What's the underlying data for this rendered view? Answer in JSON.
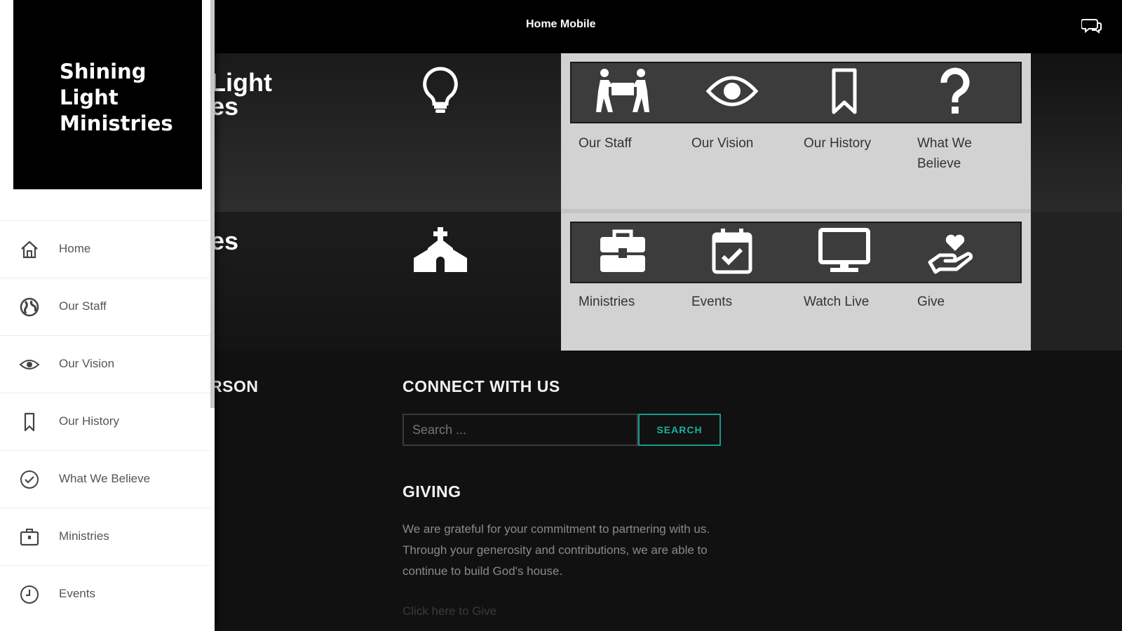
{
  "header": {
    "title": "Home Mobile",
    "chat_icon": "chat-bubbles-icon"
  },
  "hero": {
    "row1_text_line1": "Light",
    "row1_text_line2": "es",
    "row1_icon": "lightbulb-icon",
    "row2_text": "es",
    "row2_icon": "church-icon"
  },
  "panel": {
    "row1": [
      {
        "label": "Our Staff",
        "icon": "people-carrying-icon"
      },
      {
        "label": "Our Vision",
        "icon": "eye-icon"
      },
      {
        "label": "Our History",
        "icon": "bookmark-icon"
      },
      {
        "label": "What We Believe",
        "icon": "question-mark-icon"
      }
    ],
    "row2": [
      {
        "label": "Ministries",
        "icon": "toolbox-icon"
      },
      {
        "label": "Events",
        "icon": "calendar-check-icon"
      },
      {
        "label": "Watch Live",
        "icon": "monitor-icon"
      },
      {
        "label": "Give",
        "icon": "heart-hand-icon"
      }
    ]
  },
  "lower": {
    "left_partial_title": "RSON",
    "connect_title": "CONNECT WITH US",
    "search_placeholder": "Search ...",
    "search_button": "SEARCH",
    "giving_title": "GIVING",
    "giving_text": "We are grateful for your commitment to partnering with us. Through your generosity and contributions, we are able to continue to build God's house.",
    "give_link": "Click here to Give"
  },
  "drawer": {
    "logo_text": "Shining Light Ministries",
    "items": [
      {
        "label": "Home",
        "icon": "house-icon"
      },
      {
        "label": "Our Staff",
        "icon": "globe-icon"
      },
      {
        "label": "Our Vision",
        "icon": "eye-icon"
      },
      {
        "label": "Our History",
        "icon": "bookmark-icon"
      },
      {
        "label": "What We Believe",
        "icon": "check-circle-icon"
      },
      {
        "label": "Ministries",
        "icon": "briefcase-icon"
      },
      {
        "label": "Events",
        "icon": "clock-icon"
      }
    ]
  }
}
